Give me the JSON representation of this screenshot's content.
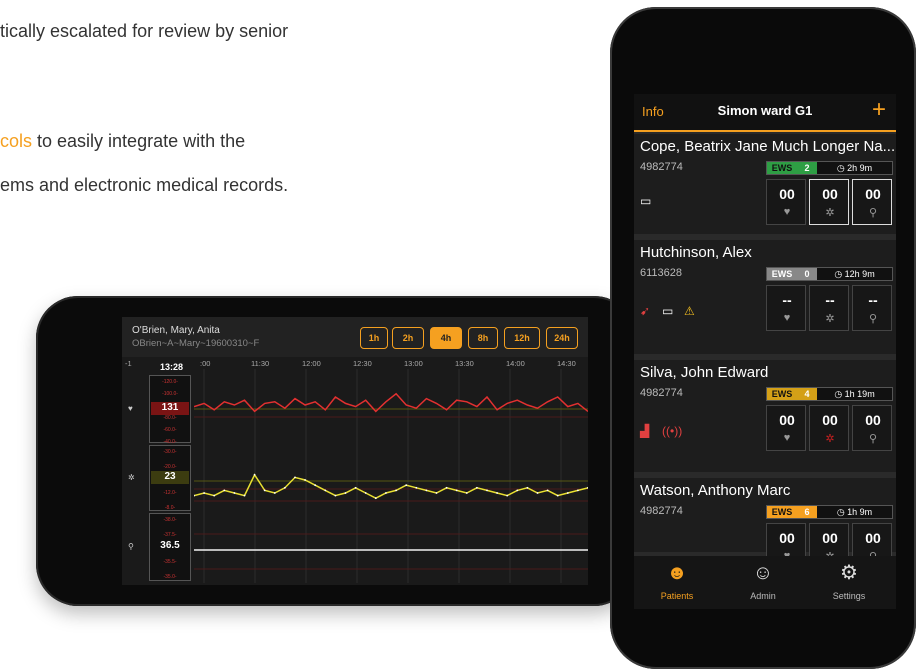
{
  "marketing": {
    "line1": "tically escalated for review by senior",
    "line2_highlight": "cols",
    "line2_rest": " to easily integrate with the",
    "line3": "ems and electronic medical records."
  },
  "landscape": {
    "patient_name": "O'Brien, Mary, Anita",
    "patient_id": "OBrien~A~Mary~19600310~F",
    "ranges": [
      "1h",
      "2h",
      "4h",
      "8h",
      "12h",
      "24h"
    ],
    "active_range": "4h",
    "time_header": "13:28",
    "time_ticks": [
      ":00",
      "11:30",
      "12:00",
      "12:30",
      "13:00",
      "13:30",
      "14:00",
      "14:30"
    ],
    "vitals": [
      {
        "icon": "heart-icon",
        "value": "131",
        "scale": [
          "-120.0-",
          "-100.0-",
          "-80.0-",
          "-60.0-",
          "-40.0-"
        ],
        "color": "#7a1414"
      },
      {
        "icon": "lungs-icon",
        "value": "23",
        "scale": [
          "-30.0-",
          "-20.0-",
          "-12.0-",
          "-8.0-"
        ],
        "color": "#3c3c10"
      },
      {
        "icon": "thermometer-icon",
        "value": "36.5",
        "scale": [
          "-38.0-",
          "-37.5-",
          "-35.5-",
          "-35.0-"
        ],
        "color": "#111111"
      }
    ],
    "hr_series": [
      115,
      117,
      113,
      118,
      116,
      119,
      112,
      117,
      118,
      114,
      120,
      116,
      118,
      113,
      121,
      117,
      115,
      119,
      112,
      118,
      123,
      116,
      114,
      120,
      117,
      113,
      119,
      118,
      115,
      121,
      113,
      117,
      119,
      116,
      114,
      118,
      121,
      115,
      117,
      112
    ],
    "rr_series": [
      14,
      15,
      14,
      16,
      15,
      14,
      22,
      16,
      15,
      17,
      21,
      20,
      18,
      16,
      14,
      15,
      17,
      15,
      13,
      15,
      16,
      18,
      17,
      16,
      15,
      17,
      16,
      15,
      17,
      16,
      15,
      14,
      16,
      17,
      15,
      16,
      14,
      15,
      16,
      17
    ],
    "temp_series": [
      36.5,
      36.5,
      36.5,
      36.5,
      36.5,
      36.5,
      36.5,
      36.5,
      36.5,
      36.5,
      36.5,
      36.5,
      36.5,
      36.5,
      36.5,
      36.5,
      36.5,
      36.5,
      36.5,
      36.5
    ]
  },
  "portrait": {
    "header": {
      "info": "Info",
      "title": "Simon ward G1",
      "plus": "+"
    },
    "patients": [
      {
        "name": "Cope, Beatrix Jane Much Longer Na...",
        "id": "4982774",
        "ews_label": "EWS",
        "ews": "2",
        "ews_color": "#2e9e44",
        "time": "2h 9m",
        "values": [
          "00",
          "00",
          "00"
        ],
        "selected": [
          false,
          true,
          true
        ]
      },
      {
        "name": "Hutchinson, Alex",
        "id": "6113628",
        "ews_label": "EWS",
        "ews": "0",
        "ews_color": "#888888",
        "time": "12h 9m",
        "values": [
          "--",
          "--",
          "--"
        ],
        "selected": [
          false,
          false,
          false
        ]
      },
      {
        "name": "Silva, John Edward",
        "id": "4982774",
        "ews_label": "EWS",
        "ews": "4",
        "ews_color": "#d4a017",
        "time": "1h 19m",
        "values": [
          "00",
          "00",
          "00"
        ],
        "selected": [
          false,
          false,
          false
        ]
      },
      {
        "name": "Watson, Anthony Marc",
        "id": "4982774",
        "ews_label": "EWS",
        "ews": "6",
        "ews_color": "#f5a020",
        "time": "1h 9m",
        "values": [
          "00",
          "00",
          "00"
        ],
        "selected": [
          false,
          false,
          false
        ]
      }
    ],
    "nav": [
      {
        "label": "Patients",
        "icon": "patient-icon",
        "active": true
      },
      {
        "label": "Admin",
        "icon": "admin-icon",
        "active": false
      },
      {
        "label": "Settings",
        "icon": "gear-icon",
        "active": false
      }
    ]
  }
}
